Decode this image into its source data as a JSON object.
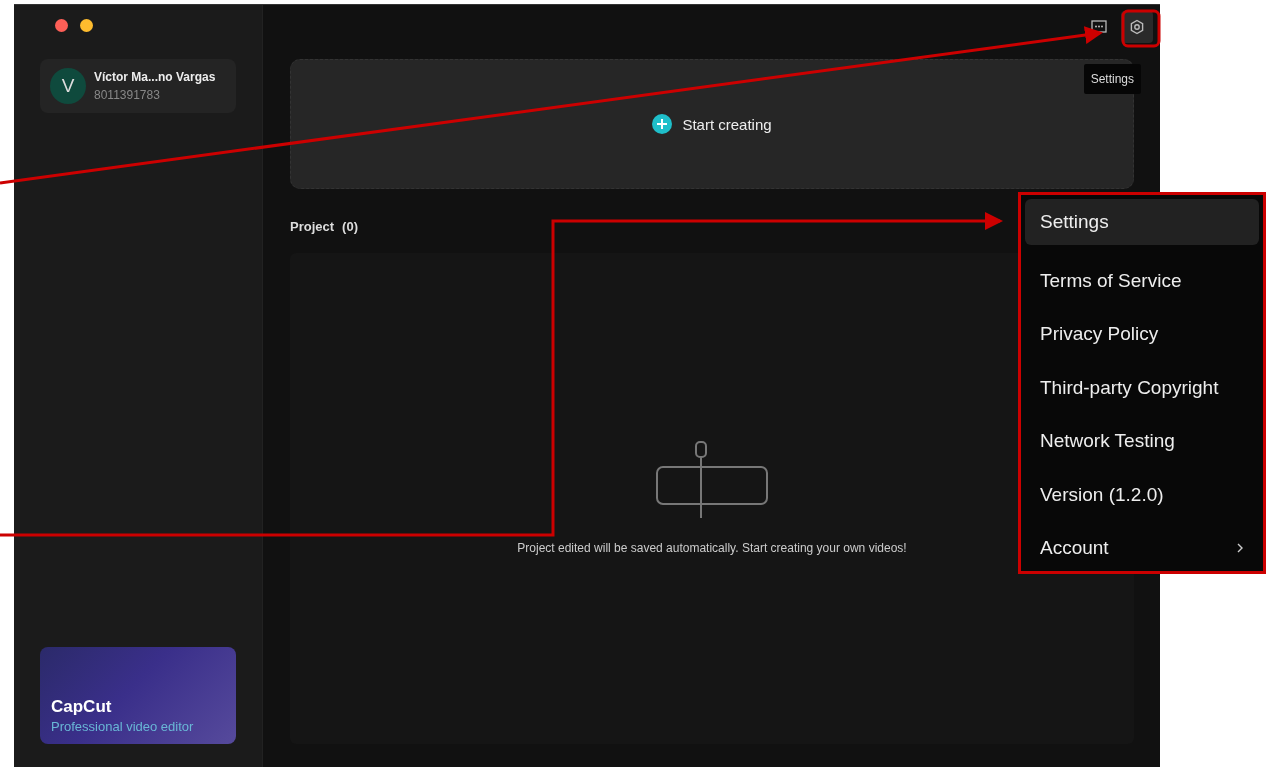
{
  "user": {
    "avatar_letter": "V",
    "name": "Víctor Ma...no Vargas",
    "id": "8011391783"
  },
  "promo": {
    "title": "CapCut",
    "subtitle": "Professional video editor"
  },
  "tooltip": "Settings",
  "start_button": "Start creating",
  "projects": {
    "heading": "Project",
    "count": "(0)",
    "empty_message": "Project edited will be saved automatically. Start creating your own videos!"
  },
  "settings_menu": [
    {
      "label": "Settings",
      "selected": true,
      "has_submenu": false
    },
    {
      "label": "Terms of Service",
      "selected": false,
      "has_submenu": false
    },
    {
      "label": "Privacy Policy",
      "selected": false,
      "has_submenu": false
    },
    {
      "label": "Third-party Copyright",
      "selected": false,
      "has_submenu": false
    },
    {
      "label": "Network Testing",
      "selected": false,
      "has_submenu": false
    },
    {
      "label": "Version (1.2.0)",
      "selected": false,
      "has_submenu": false
    },
    {
      "label": "Account",
      "selected": false,
      "has_submenu": true
    }
  ]
}
